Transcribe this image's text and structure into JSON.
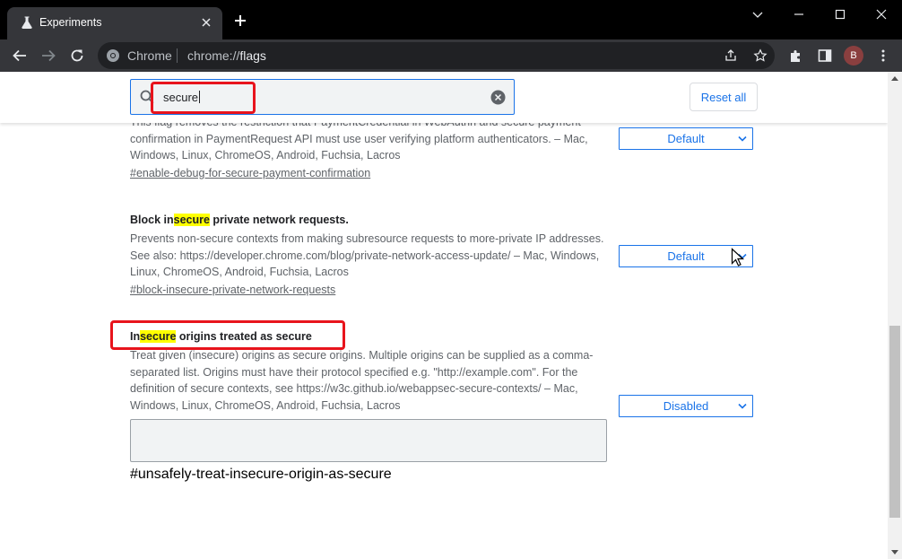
{
  "window": {
    "tab_title": "Experiments",
    "tab_icon": "flask-icon",
    "colors": {
      "titlebar": "#000000",
      "toolbar": "#35363a",
      "accent": "#1a73e8",
      "annotation": "#e8141c",
      "highlight": "#ffff00"
    }
  },
  "omnibox": {
    "chip_label": "Chrome",
    "url_prefix": "chrome://",
    "url_path": "flags"
  },
  "profile": {
    "initial": "B"
  },
  "search": {
    "query": "secure"
  },
  "header": {
    "reset_label": "Reset all"
  },
  "flags": [
    {
      "title_pre": "",
      "title_hl": "",
      "title_post": "",
      "description": "This flag removes the restriction that PaymentCredential in WebAuthn and secure payment confirmation in PaymentRequest API must use user verifying platform authenticators. – Mac, Windows, Linux, ChromeOS, Android, Fuchsia, Lacros",
      "permalink": "#enable-debug-for-secure-payment-confirmation",
      "value": "Default"
    },
    {
      "title_pre": "Block in",
      "title_hl": "secure",
      "title_post": " private network requests.",
      "description": "Prevents non-secure contexts from making subresource requests to more-private IP addresses. See also: https://developer.chrome.com/blog/private-network-access-update/ – Mac, Windows, Linux, ChromeOS, Android, Fuchsia, Lacros",
      "permalink": "#block-insecure-private-network-requests",
      "value": "Default"
    },
    {
      "title_pre": "In",
      "title_hl": "secure",
      "title_post": " origins treated as secure",
      "description": "Treat given (insecure) origins as secure origins. Multiple origins can be supplied as a comma-separated list. Origins must have their protocol specified e.g. \"http://example.com\". For the definition of secure contexts, see https://w3c.github.io/webappsec-secure-contexts/ – Mac, Windows, Linux, ChromeOS, Android, Fuchsia, Lacros",
      "permalink": "#unsafely-treat-insecure-origin-as-secure",
      "value": "Disabled",
      "textarea_value": ""
    }
  ]
}
